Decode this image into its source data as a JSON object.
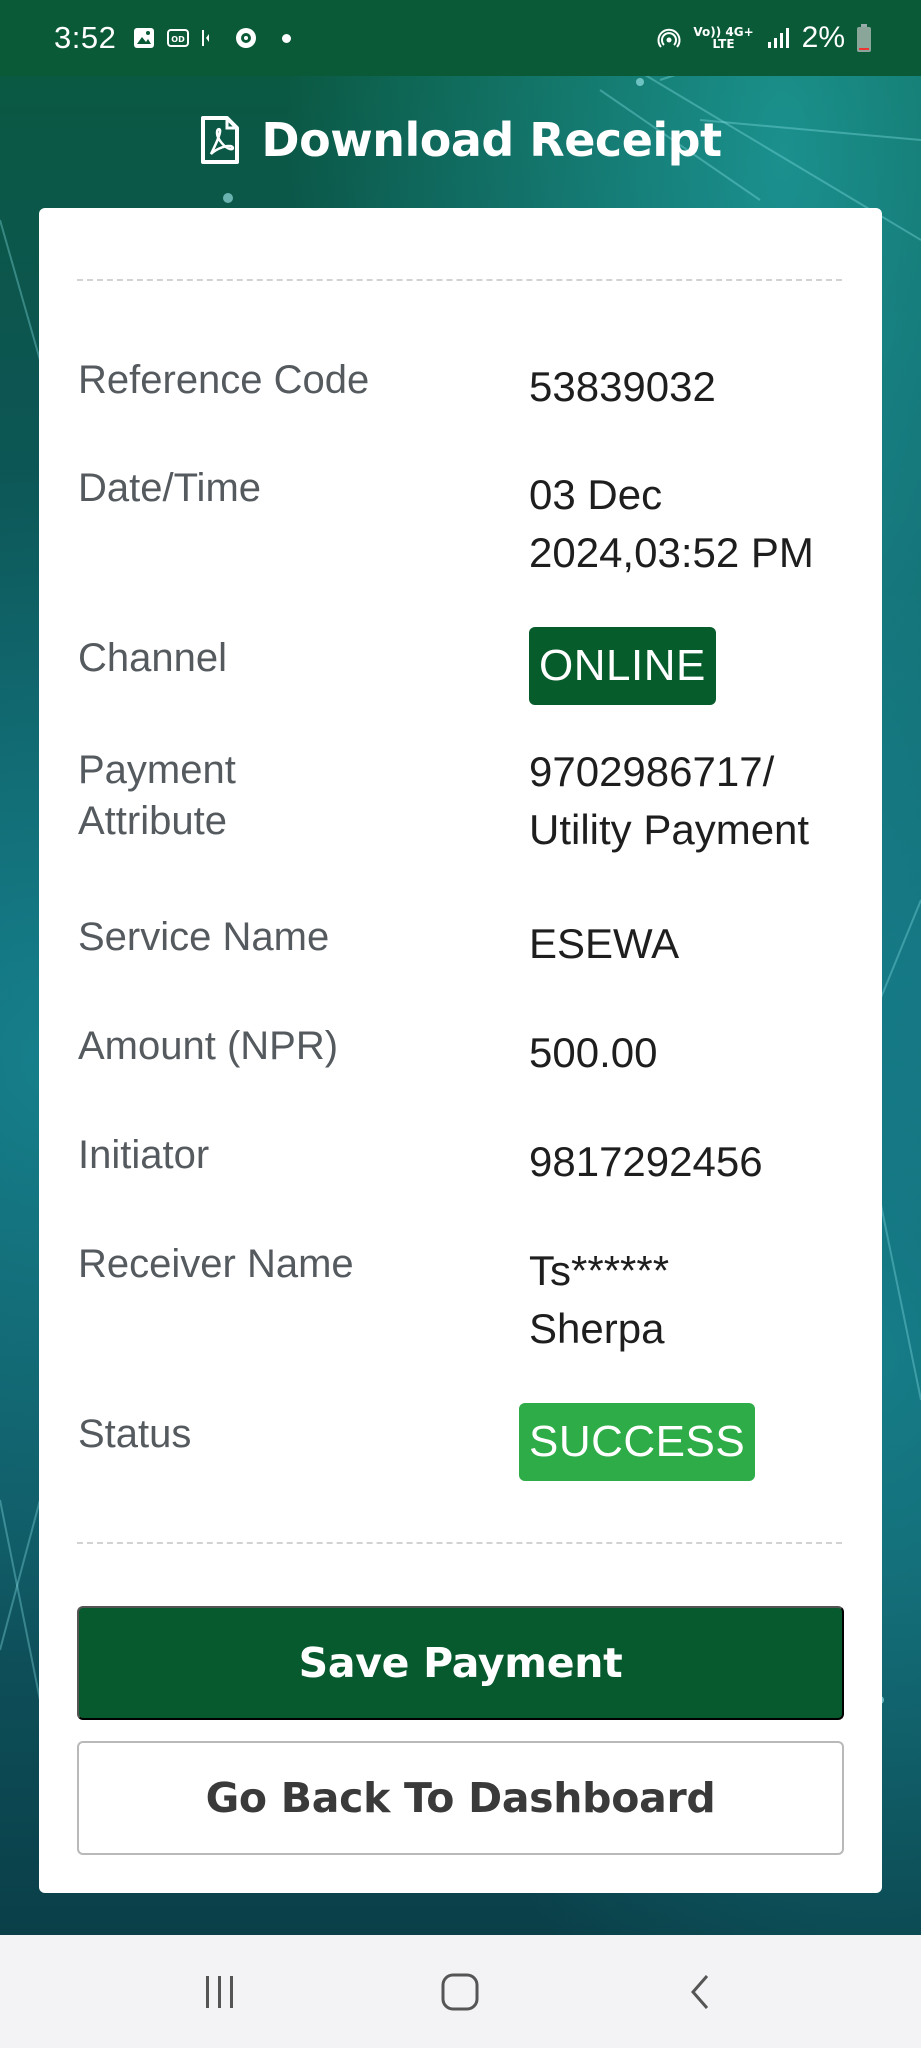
{
  "status_bar": {
    "time": "3:52",
    "battery": "2%",
    "network_top": "Vo)) 4G+",
    "network_bottom": "LTE"
  },
  "header": {
    "title": "Download Receipt",
    "icon": "pdf-file-icon"
  },
  "receipt": {
    "rows": [
      {
        "label": "Reference Code",
        "value": "53839032"
      },
      {
        "label": "Date/Time",
        "value": "03 Dec 2024,03:52 PM"
      },
      {
        "label": "Channel",
        "value": "ONLINE"
      },
      {
        "label": "Payment Attribute",
        "value": "9702986717/ Utility Payment"
      },
      {
        "label": "Service Name",
        "value": "ESEWA"
      },
      {
        "label": "Amount (NPR)",
        "value": "500.00"
      },
      {
        "label": "Initiator",
        "value": "9817292456"
      },
      {
        "label": "Receiver Name",
        "value": "Ts****** Sherpa"
      },
      {
        "label": "Status",
        "value": "SUCCESS"
      }
    ]
  },
  "actions": {
    "save_label": "Save Payment",
    "back_label": "Go Back To Dashboard"
  },
  "colors": {
    "brand_green": "#075a2e",
    "success_green": "#2eac47",
    "status_bar_bg": "#0b5a37"
  }
}
